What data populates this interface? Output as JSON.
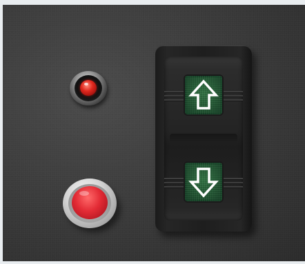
{
  "scene": {
    "type": "photo",
    "subject": "control panel",
    "background_color": "#e9edf0",
    "panel_color": "#3c3c3c"
  },
  "indicator_lamp": {
    "icon": "indicator-lamp-icon",
    "lens_color": "#e0281e",
    "state": "on"
  },
  "push_button": {
    "icon": "push-button-icon",
    "cap_color": "#e32b35",
    "bezel_color": "#d4d4d4"
  },
  "rocker_switch": {
    "body_color": "#1e1e1e",
    "lens_color": "#1d4a2c",
    "arrow_color": "#ffffff",
    "up": {
      "icon": "arrow-up-icon"
    },
    "down": {
      "icon": "arrow-down-icon"
    }
  }
}
